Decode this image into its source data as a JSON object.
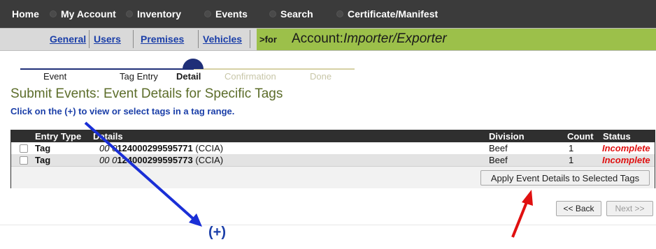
{
  "top_nav": [
    {
      "label": "Home"
    },
    {
      "label": "My Account"
    },
    {
      "label": "Inventory"
    },
    {
      "label": "Events"
    },
    {
      "label": "Search"
    },
    {
      "label": "Certificate/Manifest"
    }
  ],
  "sub_nav": {
    "links": [
      "General",
      "Users",
      "Premises",
      "Vehicles"
    ],
    "account_prefix": ">for",
    "account_label": "Account:",
    "account_type": "Importer/Exporter"
  },
  "stepper": {
    "steps": [
      {
        "label": "Event",
        "state": "done"
      },
      {
        "label": "Tag Entry",
        "state": "done"
      },
      {
        "label": "Detail",
        "state": "current"
      },
      {
        "label": "Confirmation",
        "state": "pending"
      },
      {
        "label": "Done",
        "state": "pending"
      }
    ]
  },
  "page": {
    "title": "Submit Events: Event Details for Specific Tags",
    "instruction": "Click on the (+) to view or select tags in a tag range."
  },
  "table": {
    "headers": {
      "entry_type": "Entry Type",
      "details": "Details",
      "division": "Division",
      "count": "Count",
      "status": "Status"
    },
    "rows": [
      {
        "entry_type": "Tag",
        "details_prefix": "00 0",
        "details_main": "124000299595771",
        "details_suffix": " (CCIA)",
        "division": "Beef",
        "count": "1",
        "status": "Incomplete"
      },
      {
        "entry_type": "Tag",
        "details_prefix": "00 0",
        "details_main": "124000299595773",
        "details_suffix": " (CCIA)",
        "division": "Beef",
        "count": "1",
        "status": "Incomplete"
      }
    ],
    "apply_button": "Apply Event Details to Selected Tags"
  },
  "buttons": {
    "back": "<< Back",
    "next": "Next >>"
  },
  "annotations": {
    "plus_label": "(+)"
  },
  "colors": {
    "nav_bg": "#3b3b3b",
    "account_bar": "#9cc04a",
    "link_blue": "#1a3ea8",
    "title_olive": "#5c6d2a",
    "status_red": "#e01010",
    "stepper_done": "#1f2f78",
    "stepper_pending": "#d6d0a4",
    "arrow_blue": "#1a2fd6",
    "arrow_red": "#e01010"
  },
  "icons": {
    "nav_bullet": "bullet-dot-icon",
    "row_checkbox": "checkbox-icon",
    "annotation_arrows": [
      "blue-arrow-icon",
      "red-arrow-icon"
    ]
  }
}
